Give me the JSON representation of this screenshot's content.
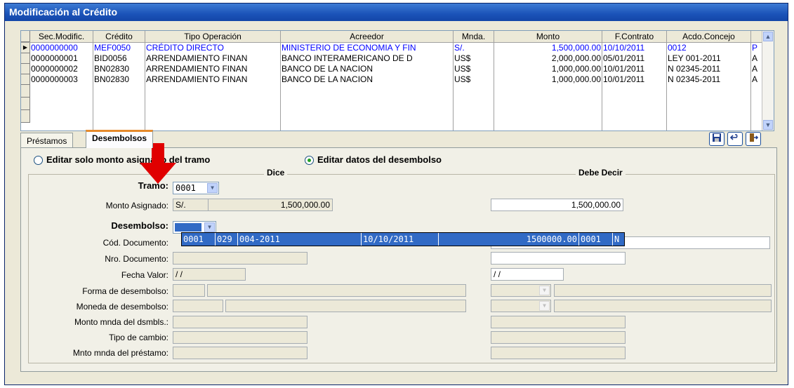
{
  "window": {
    "title": "Modificación al Crédito"
  },
  "grid": {
    "columns": [
      "Sec.Modific.",
      "Crédito",
      "Tipo Operación",
      "Acreedor",
      "Mnda.",
      "Monto",
      "F.Contrato",
      "Acdo.Concejo",
      ""
    ],
    "rows": [
      [
        "0000000000",
        "MEF0050",
        "CRÉDITO DIRECTO",
        "MINISTERIO DE ECONOMIA Y FIN",
        "S/.",
        "1,500,000.00",
        "10/10/2011",
        "0012",
        "P"
      ],
      [
        "0000000001",
        "BID0056",
        "ARRENDAMIENTO FINAN",
        "BANCO INTERAMERICANO DE D",
        "US$",
        "2,000,000.00",
        "05/01/2011",
        "LEY 001-2011",
        "A"
      ],
      [
        "0000000002",
        "BN02830",
        "ARRENDAMIENTO FINAN",
        "BANCO DE LA NACION",
        "US$",
        "1,000,000.00",
        "10/01/2011",
        "N 02345-2011",
        "A"
      ],
      [
        "0000000003",
        "BN02830",
        "ARRENDAMIENTO FINAN",
        "BANCO DE LA NACION",
        "US$",
        "1,000,000.00",
        "10/01/2011",
        "N 02345-2011",
        "A"
      ]
    ]
  },
  "tabs": {
    "prestamos": "Préstamos",
    "desembolsos": "Desembolsos"
  },
  "options": {
    "edit_monto": "Editar solo monto asignado del tramo",
    "edit_datos": "Editar datos del desembolso",
    "selected": "edit_datos"
  },
  "sections": {
    "dice": "Dice",
    "debe_decir": "Debe Decir"
  },
  "form": {
    "tramo_label": "Tramo:",
    "tramo_value": "0001",
    "monto_asignado_label": "Monto Asignado:",
    "monto_moneda": "S/.",
    "monto_asignado_value": "1,500,000.00",
    "monto_asignado_debe": "1,500,000.00",
    "desembolso_label": "Desembolso:",
    "cod_documento_label": "Cód. Documento:",
    "nro_documento_label": "Nro. Documento:",
    "fecha_valor_label": "Fecha Valor:",
    "fecha_valor_value": "/ /",
    "fecha_valor_debe": "/ /",
    "forma_label": "Forma de desembolso:",
    "moneda_label": "Moneda de desembolso:",
    "monto_mnda_label": "Monto mnda del dsmbls.:",
    "tipo_cambio_label": "Tipo de cambio:",
    "mnto_prestamo_label": "Mnto mnda del préstamo:"
  },
  "dropdown_row": [
    "0001",
    "029",
    "004-2011",
    "",
    "10/10/2011",
    "",
    "1500000.00",
    "0001",
    "N"
  ],
  "colors": {
    "title_bar": "#1b53b8",
    "selection": "#316ac5",
    "selected_text": "#0000ff",
    "arrow": "#e00000"
  }
}
